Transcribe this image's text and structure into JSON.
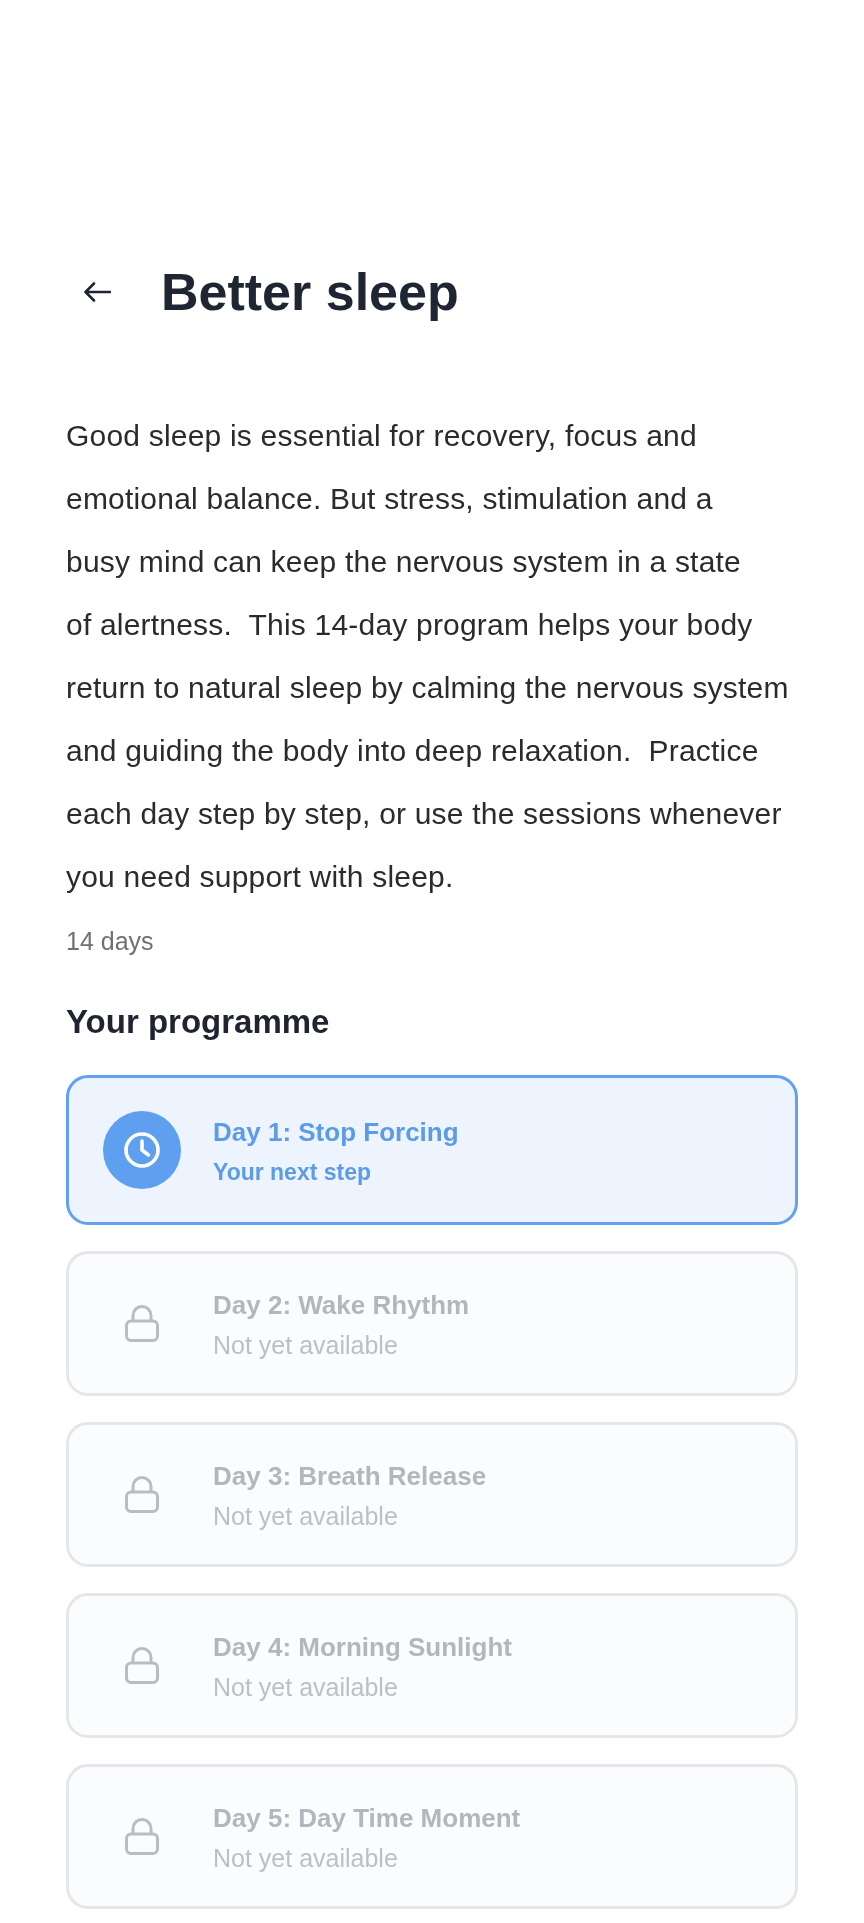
{
  "header": {
    "title": "Better sleep"
  },
  "description": "Good sleep is essential for recovery, focus and\nemotional balance. But stress, stimulation and a\nbusy mind can keep the nervous system in a state\nof alertness.  This 14-day program helps your body\nreturn to natural sleep by calming the nervous system\nand guiding the body into deep relaxation.  Practice\neach day step by step, or use the sessions whenever\nyou need support with sleep.",
  "duration": "14 days",
  "programme": {
    "heading": "Your programme",
    "days": [
      {
        "title": "Day 1: Stop Forcing",
        "subtitle": "Your next step",
        "locked": false
      },
      {
        "title": "Day 2: Wake Rhythm",
        "subtitle": "Not yet available",
        "locked": true
      },
      {
        "title": "Day 3: Breath Release",
        "subtitle": "Not yet available",
        "locked": true
      },
      {
        "title": "Day 4: Morning Sunlight",
        "subtitle": "Not yet available",
        "locked": true
      },
      {
        "title": "Day 5: Day Time Moment",
        "subtitle": "Not yet available",
        "locked": true
      }
    ]
  }
}
